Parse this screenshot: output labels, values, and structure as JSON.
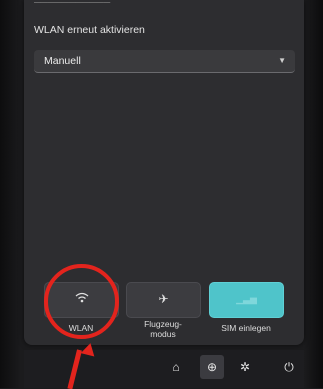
{
  "panel": {
    "section_label": "WLAN erneut aktivieren",
    "dropdown_value": "Manuell"
  },
  "tiles": [
    {
      "label": "WLAN",
      "icon": "wifi-icon"
    },
    {
      "label": "Flugzeug-\nmodus",
      "icon": "airplane-icon"
    },
    {
      "label": "SIM einlegen",
      "icon": "cellular-icon"
    }
  ],
  "system_bar": {
    "icons": [
      "battery-icon",
      "network-icon",
      "accessibility-icon",
      "power-icon"
    ]
  },
  "colors": {
    "accent": "#4fc4ca",
    "annotation": "#e3241d",
    "panel": "#2d2d30"
  }
}
